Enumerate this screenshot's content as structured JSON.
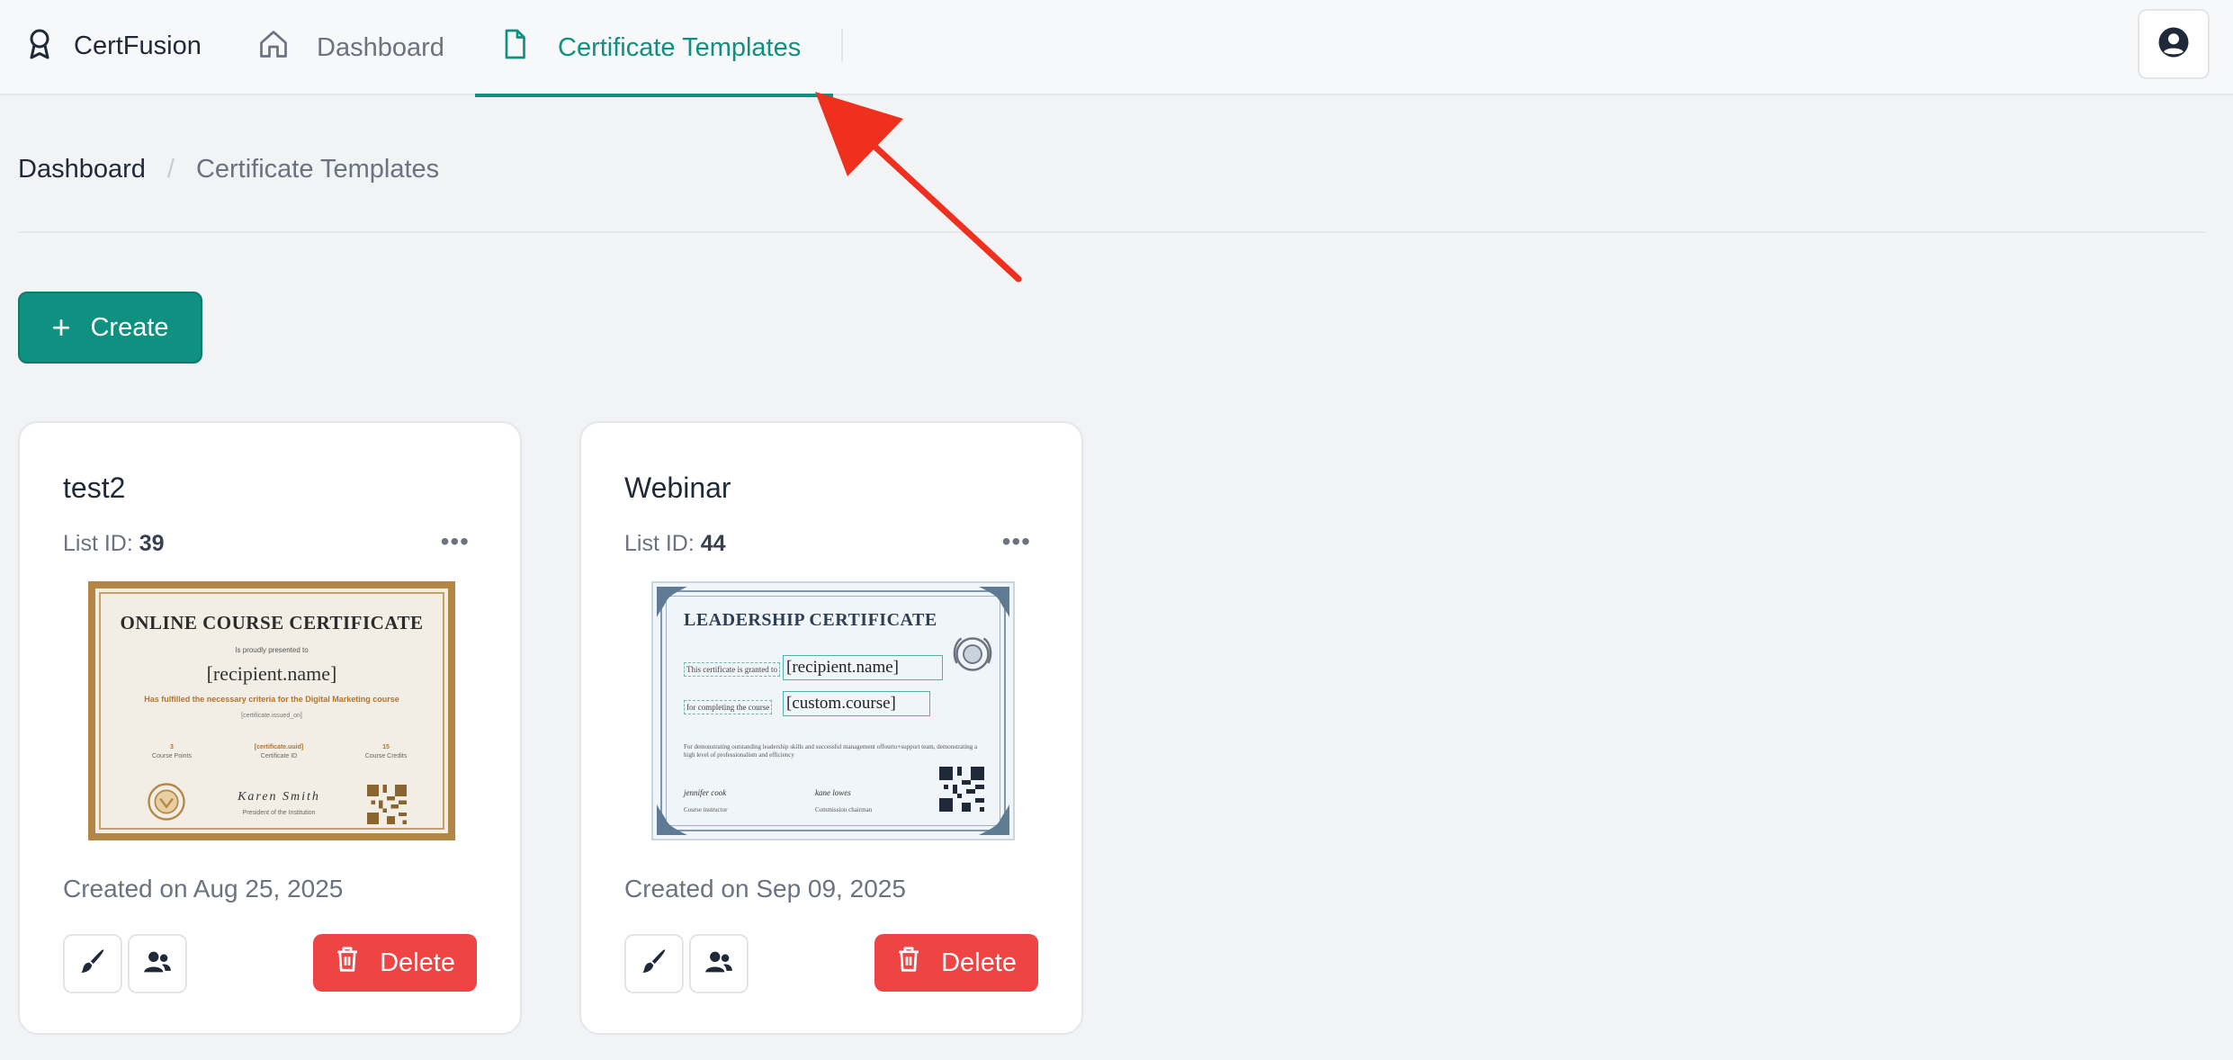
{
  "app": {
    "name": "CertFusion"
  },
  "nav": {
    "items": [
      {
        "label": "Dashboard",
        "icon": "home-icon",
        "active": false
      },
      {
        "label": "Certificate Templates",
        "icon": "file-icon",
        "active": true
      }
    ]
  },
  "breadcrumb": {
    "home": "Dashboard",
    "separator": "/",
    "current": "Certificate Templates"
  },
  "toolbar": {
    "create_label": "Create",
    "create_icon": "+"
  },
  "colors": {
    "accent": "#0f9080",
    "danger": "#ee4444",
    "annotation_arrow": "#f0301e"
  },
  "cards": [
    {
      "title": "test2",
      "list_id_label": "List ID:",
      "list_id": "39",
      "more_label": "•••",
      "created": "Created on Aug 25, 2025",
      "delete_label": "Delete",
      "certificate": {
        "title": "ONLINE COURSE CERTIFICATE",
        "subtitle": "Is proudly presented to",
        "recipient": "[recipient.name]",
        "description": "Has fulfilled the necessary criteria for the Digital Marketing course",
        "issued": "[certificate.issued_on]",
        "stats": [
          {
            "value": "3",
            "label": "Course Points"
          },
          {
            "value": "[certificate.uuid]",
            "label": "Certificate ID"
          },
          {
            "value": "15",
            "label": "Course Credits"
          }
        ],
        "signature": "Karen Smith",
        "signature_role": "President of the Institution"
      }
    },
    {
      "title": "Webinar",
      "list_id_label": "List ID:",
      "list_id": "44",
      "more_label": "•••",
      "created": "Created on Sep 09, 2025",
      "delete_label": "Delete",
      "certificate": {
        "title": "LEADERSHIP CERTIFICATE",
        "granted_label": "This certificate is granted to",
        "recipient": "[recipient.name]",
        "course_label": "for completing the course",
        "course": "[custom.course]",
        "paragraph": "For demonstrating outstanding leadership skills and successful management offourto+support team, demonstrating a high level of professionalism and efficiency",
        "signatures": [
          {
            "name": "jennifer cook",
            "role": "Course instructor"
          },
          {
            "name": "kane lowes",
            "role": "Commission chairman"
          }
        ]
      }
    }
  ]
}
